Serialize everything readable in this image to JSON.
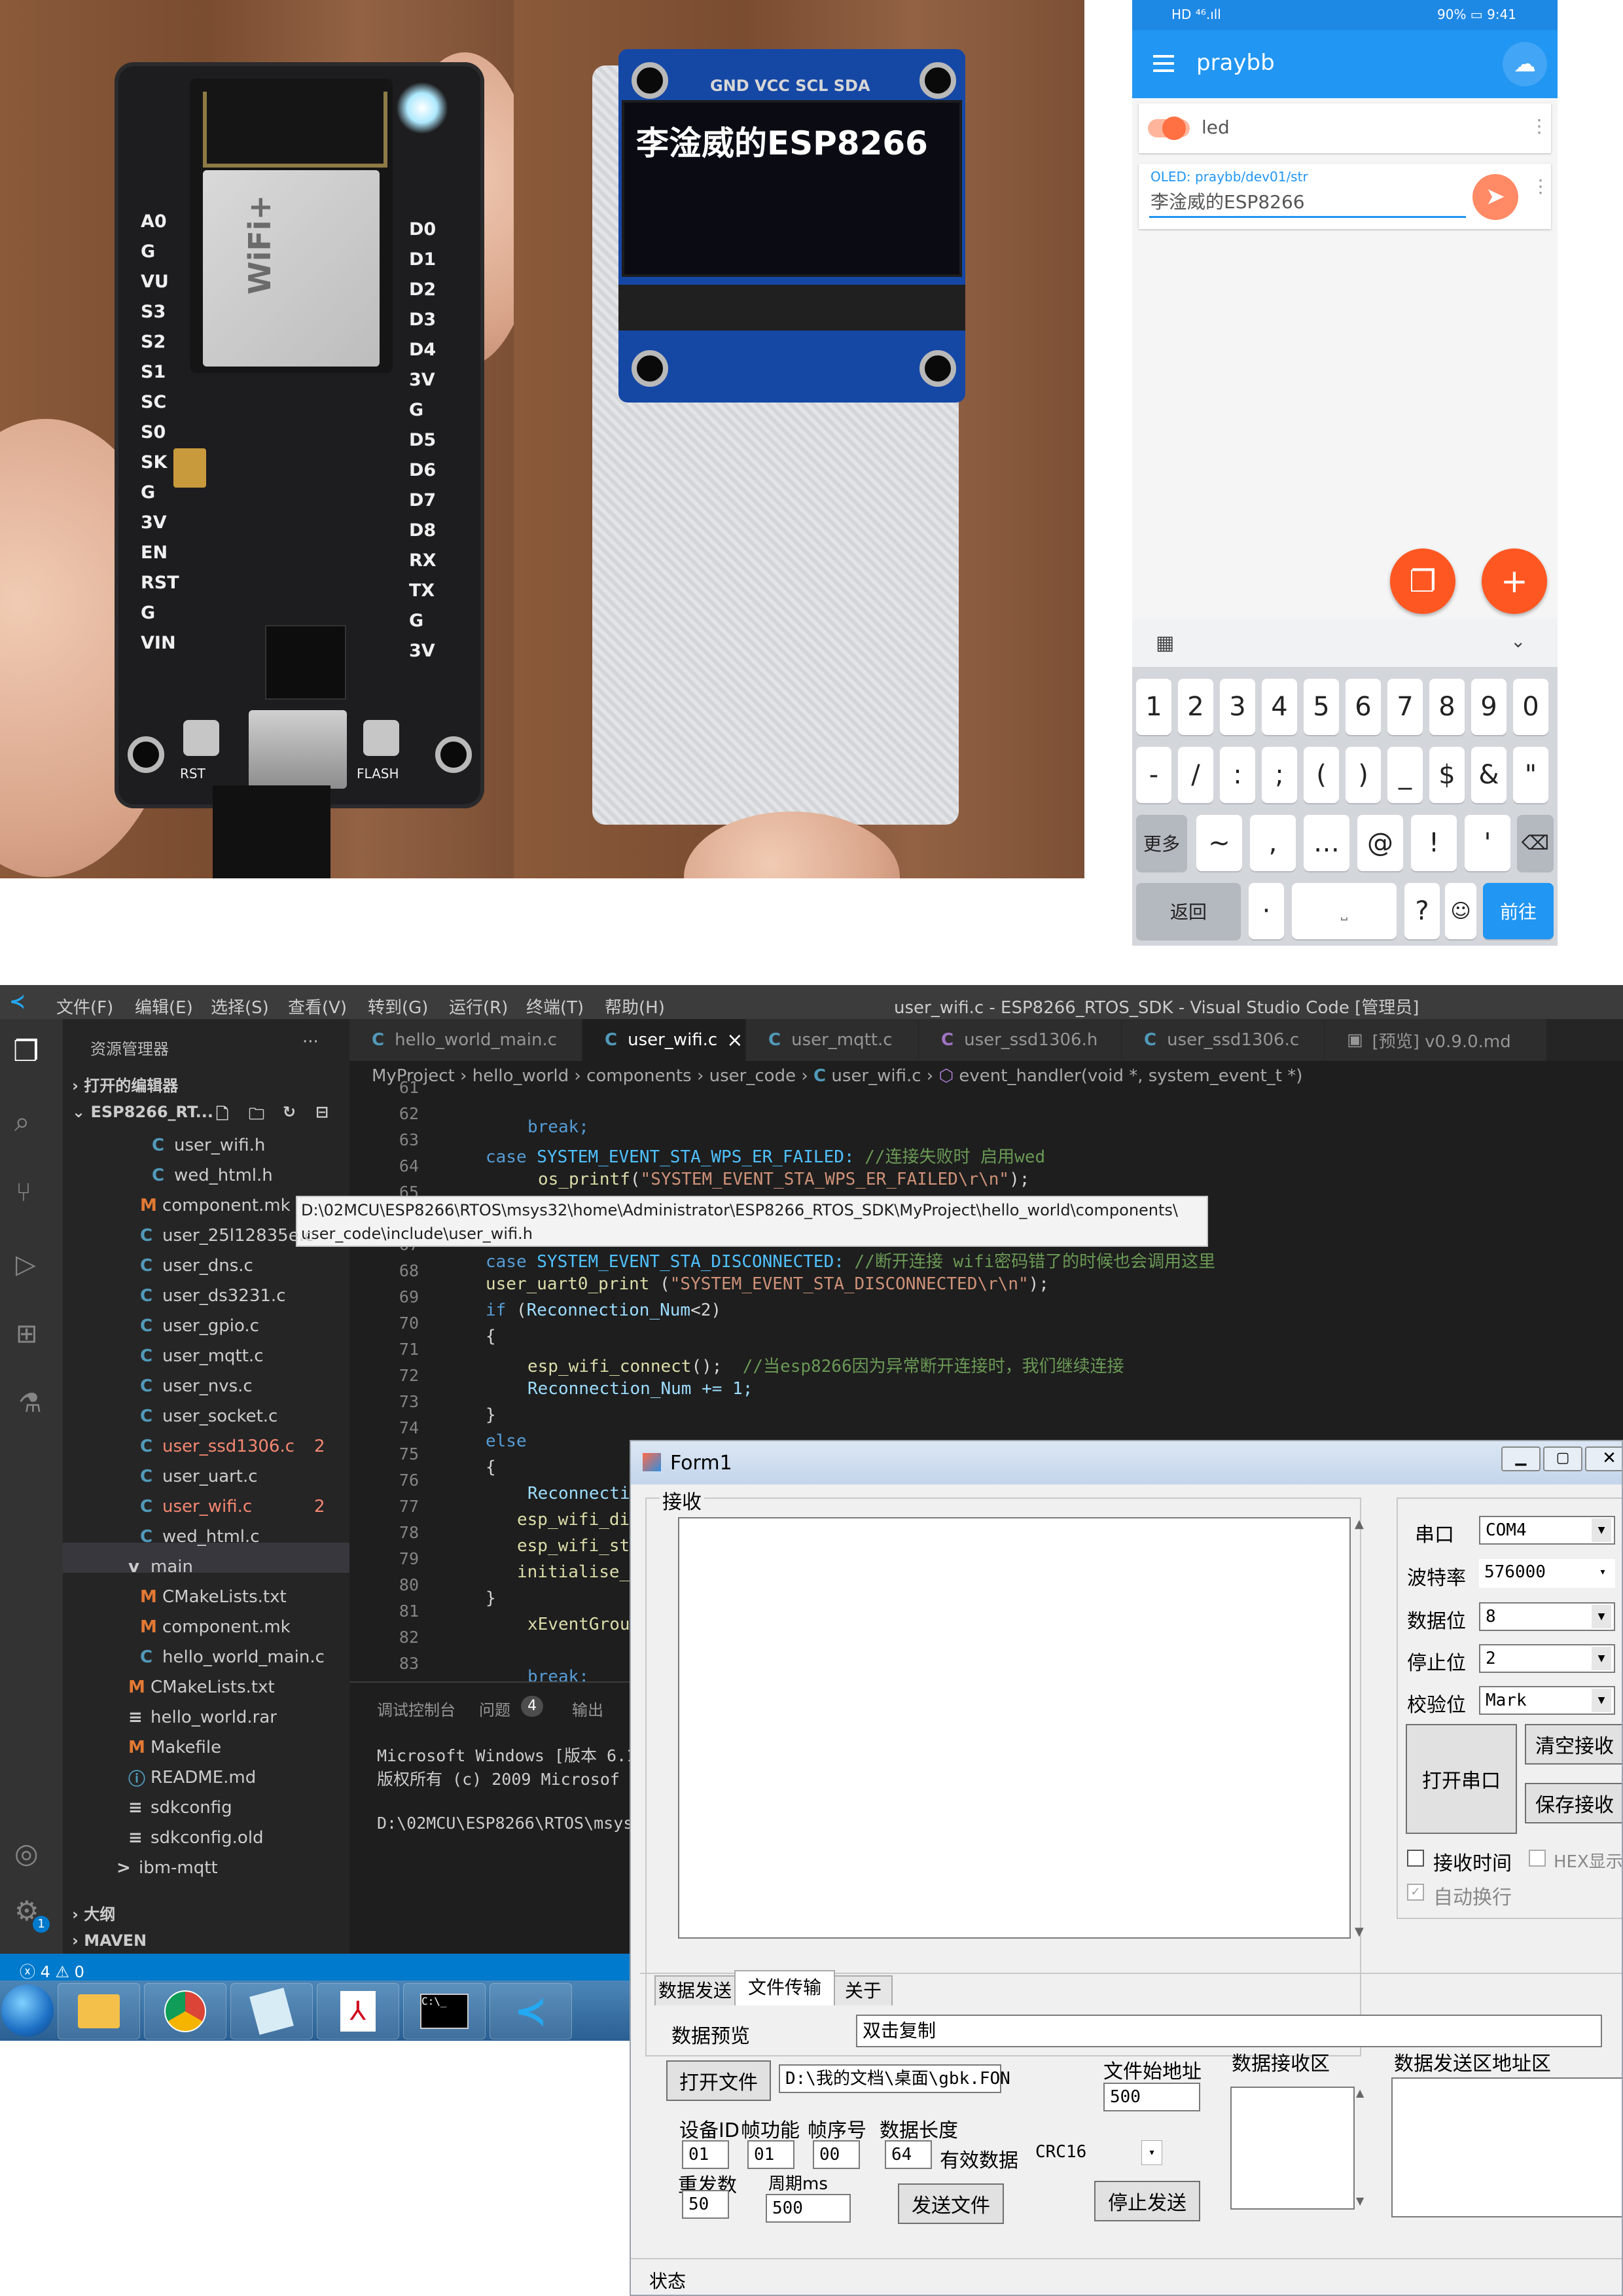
{
  "photo_left": {
    "pins_left": [
      "A0",
      "G",
      "VU",
      "S3",
      "S2",
      "S1",
      "SC",
      "S0",
      "SK",
      "G",
      "3V",
      "EN",
      "RST",
      "G",
      "VIN"
    ],
    "pins_right": [
      "D0",
      "D1",
      "D2",
      "D3",
      "D4",
      "3V",
      "G",
      "D5",
      "D6",
      "D7",
      "D8",
      "RX",
      "TX",
      "G",
      "3V"
    ],
    "module_brand": "WiFi+",
    "button_left": "RST",
    "button_right": "FLASH"
  },
  "photo_mid": {
    "oled_header": "GND VCC SCL SDA",
    "oled_text": "李淦威的ESP8266"
  },
  "phone": {
    "status_left": "HD ⁴⁶.ıll",
    "status_right": "90% ▭ 9:41",
    "app_title": "praybb",
    "switch_label": "led",
    "oled_topic": "OLED: praybb/dev01/str",
    "oled_value": "李淦威的ESP8266",
    "keys_row1": [
      "1",
      "2",
      "3",
      "4",
      "5",
      "6",
      "7",
      "8",
      "9",
      "0"
    ],
    "keys_row2": [
      "-",
      "/",
      ":",
      ";",
      "(",
      ")",
      "_",
      "$",
      "&",
      "\""
    ],
    "keys_row3": [
      "更多",
      "~",
      ",",
      "…",
      "@",
      "!",
      "'"
    ],
    "key_back": "返回",
    "key_dot": "·",
    "key_q": "?",
    "key_go": "前往",
    "accent": "#2196f3",
    "fab_color": "#ff5722"
  },
  "vscode": {
    "menu": [
      "文件(F)",
      "编辑(E)",
      "选择(S)",
      "查看(V)",
      "转到(G)",
      "运行(R)",
      "终端(T)",
      "帮助(H)"
    ],
    "window_title": "user_wifi.c - ESP8266_RTOS_SDK - Visual Studio Code [管理员]",
    "explorer_title": "资源管理器",
    "explorer_more": "···",
    "open_editors": "打开的编辑器",
    "project": "ESP8266_RT...",
    "tabs": [
      {
        "label": "hello_world_main.c"
      },
      {
        "label": "user_wifi.c"
      },
      {
        "label": "user_mqtt.c"
      },
      {
        "label": "user_ssd1306.h"
      },
      {
        "label": "user_ssd1306.c"
      },
      {
        "label": "[预览] v0.9.0.md"
      }
    ],
    "tab_close": "×",
    "breadcrumb": [
      "MyProject",
      "hello_world",
      "components",
      "user_code",
      "user_wifi.c",
      "event_handler(void *, system_event_t *)"
    ],
    "tree": [
      {
        "icon": "C",
        "name": "user_wifi.h",
        "indent": 2,
        "badge": ""
      },
      {
        "icon": "C",
        "name": "wed_html.h",
        "indent": 2,
        "badge": ""
      },
      {
        "icon": "M",
        "name": "component.mk",
        "indent": 1,
        "badge": ""
      },
      {
        "icon": "C",
        "name": "user_25l12835e.c",
        "indent": 1,
        "badge": ""
      },
      {
        "icon": "C",
        "name": "user_dns.c",
        "indent": 1,
        "badge": ""
      },
      {
        "icon": "C",
        "name": "user_ds3231.c",
        "indent": 1,
        "badge": ""
      },
      {
        "icon": "C",
        "name": "user_gpio.c",
        "indent": 1,
        "badge": ""
      },
      {
        "icon": "C",
        "name": "user_mqtt.c",
        "indent": 1,
        "badge": ""
      },
      {
        "icon": "C",
        "name": "user_nvs.c",
        "indent": 1,
        "badge": ""
      },
      {
        "icon": "C",
        "name": "user_socket.c",
        "indent": 1,
        "badge": ""
      },
      {
        "icon": "C",
        "name": "user_ssd1306.c",
        "indent": 1,
        "badge": "2"
      },
      {
        "icon": "C",
        "name": "user_uart.c",
        "indent": 1,
        "badge": ""
      },
      {
        "icon": "C",
        "name": "user_wifi.c",
        "indent": 1,
        "badge": "2"
      },
      {
        "icon": "C",
        "name": "wed_html.c",
        "indent": 1,
        "badge": ""
      },
      {
        "icon": "v",
        "name": "main",
        "indent": 0,
        "badge": ""
      },
      {
        "icon": "M",
        "name": "CMakeLists.txt",
        "indent": 1,
        "badge": ""
      },
      {
        "icon": "M",
        "name": "component.mk",
        "indent": 1,
        "badge": ""
      },
      {
        "icon": "C",
        "name": "hello_world_main.c",
        "indent": 1,
        "badge": ""
      },
      {
        "icon": "M",
        "name": "CMakeLists.txt",
        "indent": 0,
        "badge": ""
      },
      {
        "icon": "≡",
        "name": "hello_world.rar",
        "indent": 0,
        "badge": ""
      },
      {
        "icon": "M",
        "name": "Makefile",
        "indent": 0,
        "badge": ""
      },
      {
        "icon": "ⓘ",
        "name": "README.md",
        "indent": 0,
        "badge": ""
      },
      {
        "icon": "≡",
        "name": "sdkconfig",
        "indent": 0,
        "badge": ""
      },
      {
        "icon": "≡",
        "name": "sdkconfig.old",
        "indent": 0,
        "badge": ""
      },
      {
        "icon": ">",
        "name": "ibm-mqtt",
        "indent": -1,
        "badge": ""
      }
    ],
    "outline": "大纲",
    "maven": "MAVEN",
    "tooltip_line1": "D:\\02MCU\\ESP8266\\RTOS\\msys32\\home\\Administrator\\ESP8266_RTOS_SDK\\MyProject\\hello_world\\components\\",
    "tooltip_line2": "user_code\\include\\user_wifi.h",
    "line_numbers": [
      "61",
      "62",
      "63",
      "64",
      "65",
      "66",
      "67",
      "68",
      "69",
      "70",
      "71",
      "72",
      "73",
      "74",
      "75",
      "76",
      "77",
      "78",
      "79",
      "80",
      "81",
      "82",
      "83"
    ],
    "code_62": "break;",
    "code_63_kw": "case",
    "code_63_mac": "SYSTEM_EVENT_STA_WPS_ER_FAILED:",
    "code_63_cm": "//连接失败时 启用wed",
    "code_64_fn": "os_printf",
    "code_64_str": "\"SYSTEM_EVENT_STA_WPS_ER_FAILED\\r\\n\"",
    "code_67_mac": "SYSTEM_EVENT_STA_DISCONNECTED:",
    "code_67_cm": "//断开连接 wifi密码错了的时候也会调用这里",
    "code_68_fn": "user_uart0_print",
    "code_68_str": "\"SYSTEM_EVENT_STA_DISCONNECTED\\r\\n\"",
    "code_69_kw": "if",
    "code_69_var": "Reconnection_Num",
    "code_69_rest": "<2)",
    "code_71_fn": "esp_wifi_connect",
    "code_71_cm": "//当esp8266因为异常断开连接时，我们继续连接",
    "code_72": "Reconnection_Num += 1;",
    "code_74_kw": "else",
    "code_76": "Reconnecti",
    "code_77": "esp_wifi_di",
    "code_78": "esp_wifi_st",
    "code_79": "initialise_",
    "code_81": "xEventGrou",
    "code_83": "break;",
    "panel_tabs": [
      "调试控制台",
      "问题",
      "输出"
    ],
    "problems_count": "4",
    "terminal_1": "Microsoft Windows [版本 6.1",
    "terminal_2": "版权所有 (c) 2009 Microsof",
    "terminal_3": "D:\\02MCU\\ESP8266\\RTOS\\msys",
    "status_errors": "ⓧ 4 ⚠ 0",
    "settings_badge": "1"
  },
  "form": {
    "title": "Form1",
    "receive_group": "接收",
    "port_label": "串口",
    "port_value": "COM4",
    "baud_label": "波特率",
    "baud_value": "576000",
    "databits_label": "数据位",
    "databits_value": "8",
    "stopbits_label": "停止位",
    "stopbits_value": "2",
    "parity_label": "校验位",
    "parity_value": "Mark",
    "open_port": "打开串口",
    "clear_receive": "清空接收",
    "save_receive": "保存接收",
    "receive_time": "接收时间",
    "hex_display": "HEX显示",
    "auto_newline": "自动换行",
    "tabs": [
      "数据发送",
      "文件传输",
      "关于"
    ],
    "preview_label": "数据预览",
    "preview_value": "双击复制",
    "open_file": "打开文件",
    "file_path": "D:\\我的文档\\桌面\\gbk.FON",
    "file_start_label": "文件始地址",
    "file_start_value": "500",
    "recv_area_label": "数据接收区",
    "send_area_label": "数据发送区地址区",
    "device_id_label": "设备ID",
    "device_id_value": "01",
    "frame_func_label": "帧功能",
    "frame_func_value": "01",
    "frame_seq_label": "帧序号",
    "frame_seq_value": "00",
    "data_len_label": "数据长度",
    "data_len_value": "64",
    "valid_data_label": "有效数据",
    "valid_data_value": "CRC16",
    "resend_label": "重发数",
    "resend_value": "50",
    "period_label": "周期ms",
    "period_value": "500",
    "send_file": "发送文件",
    "stop_send": "停止发送",
    "status": "状态"
  }
}
